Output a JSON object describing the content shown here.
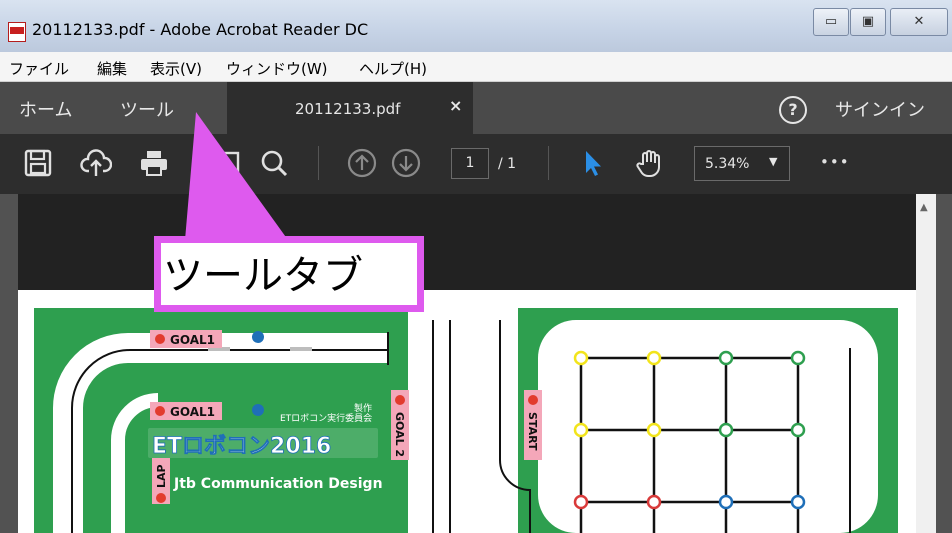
{
  "window": {
    "title": "20112133.pdf - Adobe Acrobat Reader DC",
    "minimize_symbol": "▭",
    "maximize_symbol": "▣",
    "close_symbol": "✕"
  },
  "menubar": {
    "items": [
      "ファイル",
      "編集",
      "表示(V)",
      "ウィンドウ(W)",
      "ヘルプ(H)"
    ]
  },
  "tabbar": {
    "home": "ホーム",
    "tools": "ツール",
    "document_tab": "20112133.pdf",
    "close_symbol": "×",
    "help_symbol": "?",
    "sign_in": "サインイン"
  },
  "toolbar": {
    "icons": [
      "save-icon",
      "upload-icon",
      "print-icon",
      "email-icon",
      "search-icon",
      "page-up-icon",
      "page-down-icon",
      "select-pointer-icon",
      "hand-tool-icon",
      "more-icon"
    ],
    "current_page": "1",
    "page_total": "/ 1",
    "zoom": "5.34%",
    "zoom_caret": "▼",
    "more_symbol": "•••"
  },
  "callout": {
    "text": "ツールタブ"
  },
  "pdf_map": {
    "labels": {
      "goal1_top": "GOAL1",
      "goal1_mid": "GOAL1",
      "goal2": "GOAL 2",
      "start": "START",
      "lap": "LAP",
      "producer_line1": "製作",
      "producer_line2": "ETロボコン実行委員会",
      "logo_text": "ETロボコン2016",
      "designer": "Jtb Communication Design"
    },
    "colors": {
      "field_green": "#2e9f4f",
      "label_pink": "#f4a7b9",
      "marker_red": "#e23b2e",
      "marker_blue": "#1f6fb8",
      "node_yellow": "#f2e41b",
      "node_green": "#2e9f4f",
      "node_red": "#d93a3a",
      "node_blue": "#1f6fb8",
      "callout_magenta": "#de5aee",
      "accent_blue": "#2b8fe6"
    },
    "grid_nodes": [
      [
        "yellow",
        "yellow",
        "green",
        "green"
      ],
      [
        "yellow",
        "yellow",
        "green",
        "green"
      ],
      [
        "red",
        "red",
        "blue",
        "blue"
      ]
    ]
  }
}
